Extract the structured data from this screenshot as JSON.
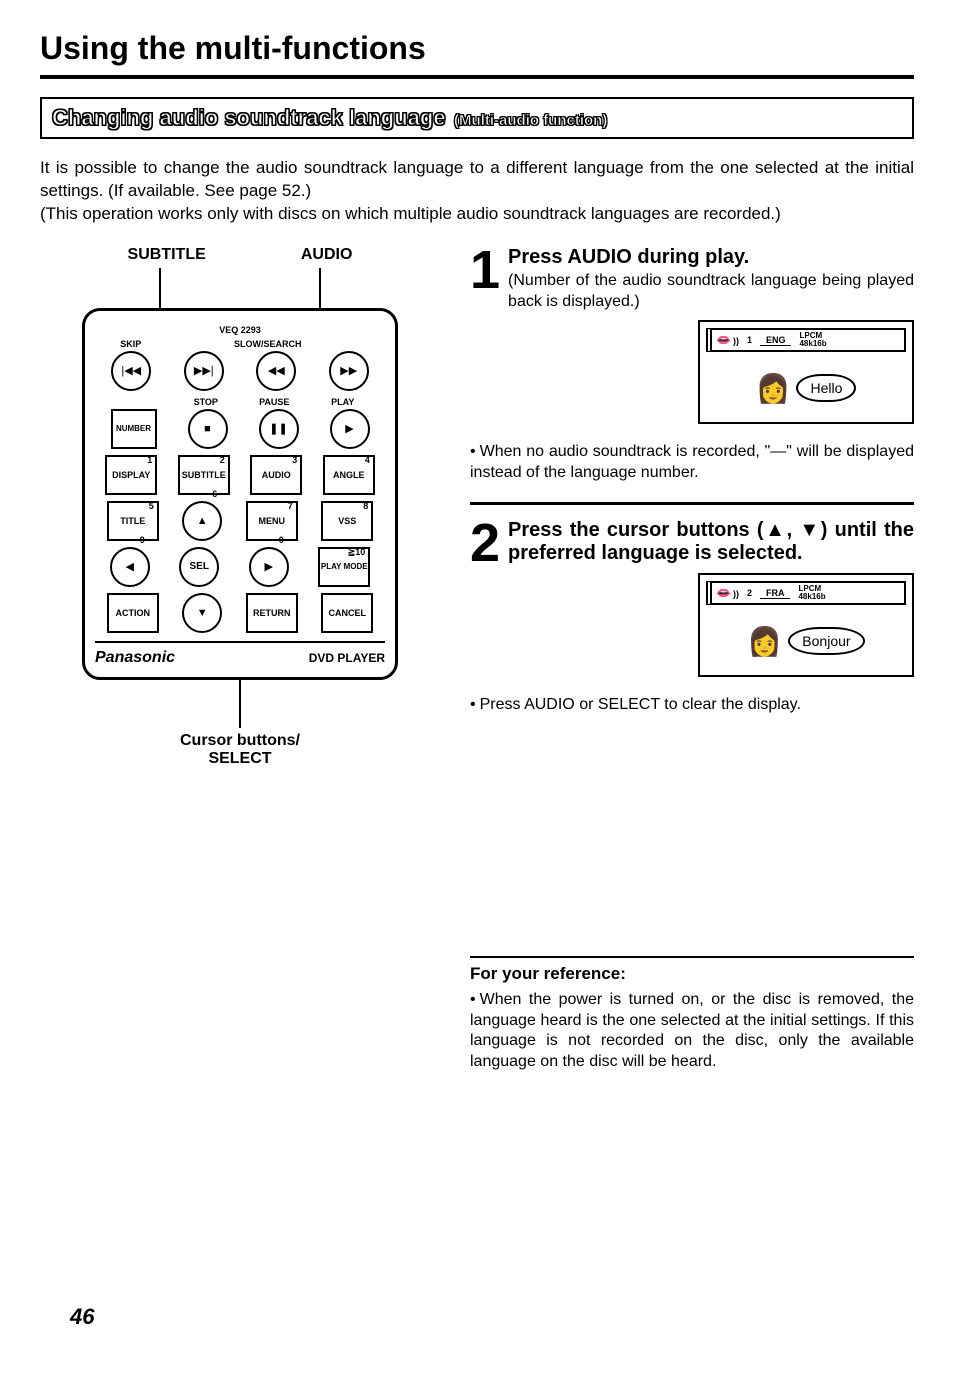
{
  "title": "Using the multi-functions",
  "section": {
    "main": "Changing audio soundtrack language",
    "sub": "(Multi-audio function)"
  },
  "intro": "It is possible to change the audio soundtrack language to a different language from the one selected at the initial settings. (If available. See page 52.)\n(This operation works only with discs on which multiple audio soundtrack languages are recorded.)",
  "remote": {
    "label_subtitle": "SUBTITLE",
    "label_audio": "AUDIO",
    "model": "VEQ 2293",
    "head1": [
      "SKIP",
      "",
      "SLOW/SEARCH",
      ""
    ],
    "row1_icons": [
      "|◀◀",
      "▶▶|",
      "◀◀",
      "▶▶"
    ],
    "head2": [
      "",
      "STOP",
      "PAUSE",
      "PLAY"
    ],
    "row2_labels": [
      "NUMBER",
      "■",
      "❚❚",
      "▶"
    ],
    "row3_corner": [
      "1",
      "2",
      "3",
      "4"
    ],
    "row3": [
      "DISPLAY",
      "SUBTITLE",
      "AUDIO",
      "ANGLE"
    ],
    "row4_corner": [
      "5",
      "6",
      "7",
      "8"
    ],
    "row4": [
      "TITLE",
      "▲",
      "MENU",
      "VSS"
    ],
    "row5_corner": [
      "9",
      "",
      "0",
      "≧10"
    ],
    "row5": [
      "◀",
      "SEL",
      "▶",
      "PLAY MODE"
    ],
    "row6": [
      "ACTION",
      "▼",
      "RETURN",
      "CANCEL"
    ],
    "brand": "Panasonic",
    "brand_sub": "DVD PLAYER",
    "bottom_label": "Cursor buttons/\nSELECT"
  },
  "step1": {
    "num": "1",
    "title": "Press AUDIO during play.",
    "text": "(Number of the audio soundtrack language being played back is displayed.)",
    "display": {
      "idx": "1",
      "lang": "ENG",
      "fmt": "LPCM",
      "rate": "48k16b"
    },
    "bubble": "Hello",
    "note": "When no audio soundtrack is recorded, \"—\" will be displayed instead of the language number."
  },
  "step2": {
    "num": "2",
    "title": "Press the cursor buttons (▲, ▼) until the preferred language is selected.",
    "display": {
      "idx": "2",
      "lang": "FRA",
      "fmt": "LPCM",
      "rate": "48k16b"
    },
    "bubble": "Bonjour",
    "note": "Press AUDIO or SELECT to clear the display."
  },
  "reference": {
    "title": "For your reference:",
    "text": "When the power is turned on, or the disc is removed, the language heard is the one selected at the initial settings. If this language is not recorded on the disc, only the available language on the disc will be heard."
  },
  "page_number": "46"
}
